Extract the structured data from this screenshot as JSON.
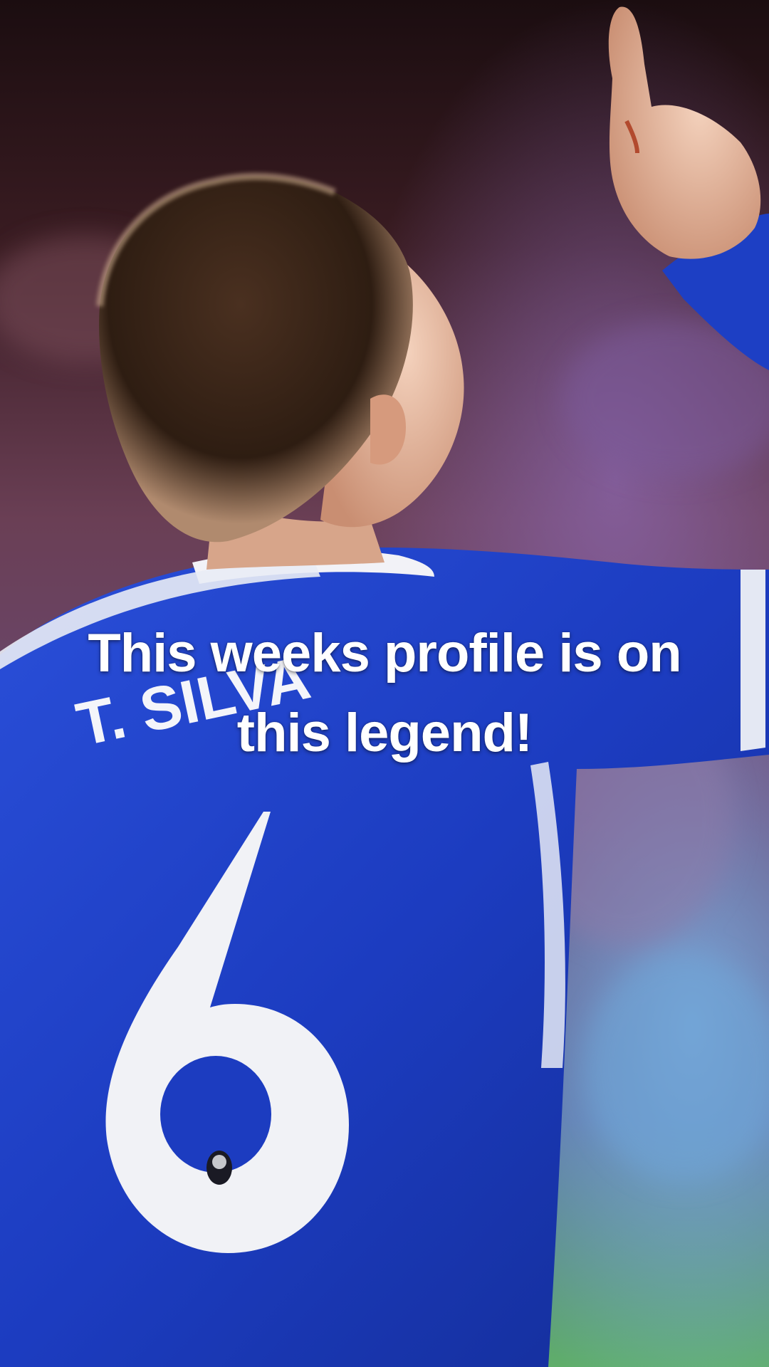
{
  "overlay": {
    "line1": "This weeks profile is on",
    "line2": "this legend!"
  },
  "photo": {
    "subject": "football player celebrating, pointing upward, seen from behind",
    "shirt_name": "T. SILVA",
    "shirt_number": "6",
    "colors": {
      "shirt": "#1d3fc4",
      "shirt_dark": "#122a8f",
      "background_top": "#2a1418",
      "background_mid": "#6b3e5a",
      "hair": "#3a2518",
      "skin": "#e4b89d"
    }
  }
}
